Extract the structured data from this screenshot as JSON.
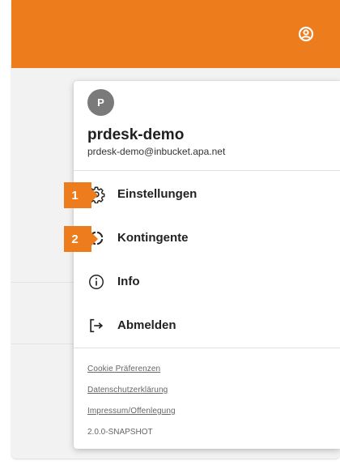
{
  "colors": {
    "accent": "#ec7c1c",
    "avatar_bg": "#7a7a7a"
  },
  "header": {
    "account_icon": "user-circle-icon"
  },
  "user": {
    "avatar_initial": "P",
    "name": "prdesk-demo",
    "email": "prdesk-demo@inbucket.apa.net"
  },
  "menu": {
    "items": [
      {
        "label": "Einstellungen",
        "icon": "gear-icon"
      },
      {
        "label": "Kontingente",
        "icon": "quota-ring-icon"
      },
      {
        "label": "Info",
        "icon": "info-icon"
      },
      {
        "label": "Abmelden",
        "icon": "logout-icon"
      }
    ]
  },
  "footer": {
    "links": [
      "Cookie Präferenzen",
      "Datenschutzerklärung",
      "Impressum/Offenlegung"
    ],
    "version": "2.0.0-SNAPSHOT"
  },
  "callouts": [
    "1",
    "2"
  ]
}
